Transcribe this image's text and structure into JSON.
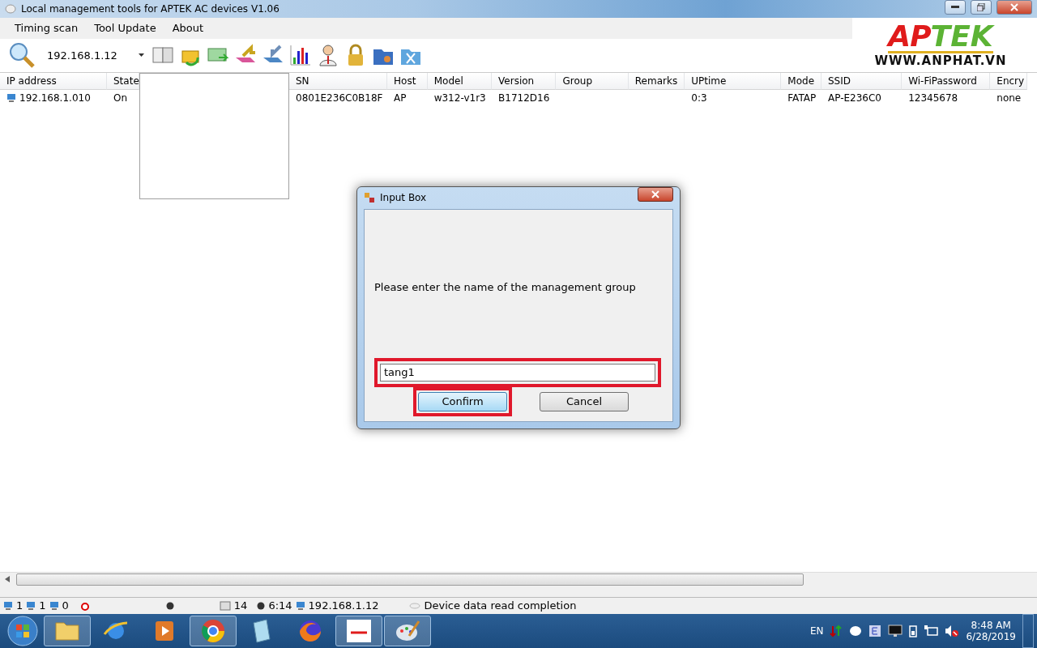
{
  "window": {
    "title": "Local management tools for APTEK AC devices  V1.06"
  },
  "menu": [
    "Timing scan",
    "Tool Update",
    "About"
  ],
  "toolbar": {
    "address": "192.168.1.12"
  },
  "logo": {
    "part_1": "AP",
    "part_2": "TEK",
    "url": "WWW.ANPHAT.VN"
  },
  "left_table": {
    "columns": [
      "IP address",
      "State"
    ],
    "rows": [
      {
        "cells": [
          "192.168.1.010",
          "On"
        ]
      }
    ]
  },
  "right_table": {
    "columns": [
      "SN",
      "Host",
      "Model",
      "Version",
      "Group",
      "Remarks",
      "UPtime",
      "Mode",
      "SSID",
      "Wi-FiPassword",
      "Encry"
    ],
    "rows": [
      {
        "cells": [
          "0801E236C0B18F",
          "AP",
          "w312-v1r3",
          "B1712D16",
          "",
          "",
          "0:3",
          "FATAP",
          "AP-E236C0",
          "12345678",
          "none"
        ]
      }
    ]
  },
  "dialog": {
    "title": "Input Box",
    "message": "Please enter the name of the management group",
    "value": "tang1",
    "buttons": [
      "Confirm",
      "Cancel"
    ]
  },
  "status_bar": {
    "online": "1",
    "devices": "1",
    "offline": "0",
    "pages": "14",
    "time": "6:14",
    "host": "192.168.1.12",
    "message": "Device data read completion"
  },
  "taskbar": {
    "apps": [
      {
        "running": true
      },
      {
        "running": false
      },
      {
        "running": false
      },
      {
        "running": true
      },
      {
        "running": false
      },
      {
        "running": false
      },
      {
        "running": true
      },
      {
        "running": true
      }
    ],
    "language": "EN",
    "time": "8:48 AM",
    "date": "6/28/2019"
  }
}
